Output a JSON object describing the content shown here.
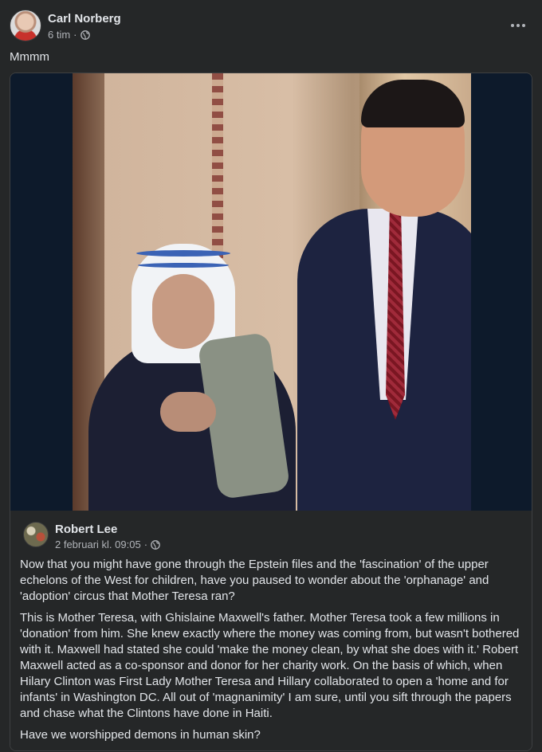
{
  "post": {
    "author": "Carl Norberg",
    "time": "6 tim",
    "separator": "·",
    "privacy_icon": "globe-icon",
    "more_icon": "more-options-icon",
    "text": "Mmmm"
  },
  "shared": {
    "author": "Robert Lee",
    "timestamp": "2 februari kl. 09:05",
    "separator": "·",
    "privacy_icon": "globe-icon",
    "paragraphs": [
      "Now that you might have gone through the Epstein files and the 'fascination' of the upper echelons of the West for children, have you paused to wonder about the 'orphanage' and 'adoption' circus that Mother Teresa ran?",
      "This is Mother Teresa, with Ghislaine Maxwell's father. Mother Teresa took a few millions in 'donation' from him. She knew exactly where the money was coming from, but wasn't bothered with it. Maxwell had stated she could 'make the money clean, by what she does with it.' Robert Maxwell acted as a co-sponsor and donor for her charity work. On the basis of which, when Hilary Clinton was First Lady Mother Teresa and Hillary collaborated to open a 'home and for infants' in Washington DC. All out of 'magnanimity' I am sure, until you sift through the papers and chase what the Clintons have done in Haiti.",
      "Have we worshipped demons in human skin?"
    ]
  },
  "colors": {
    "background": "#252728",
    "text_primary": "#e2e5e9",
    "text_secondary": "#b0b3b8",
    "border": "#3e4042"
  }
}
